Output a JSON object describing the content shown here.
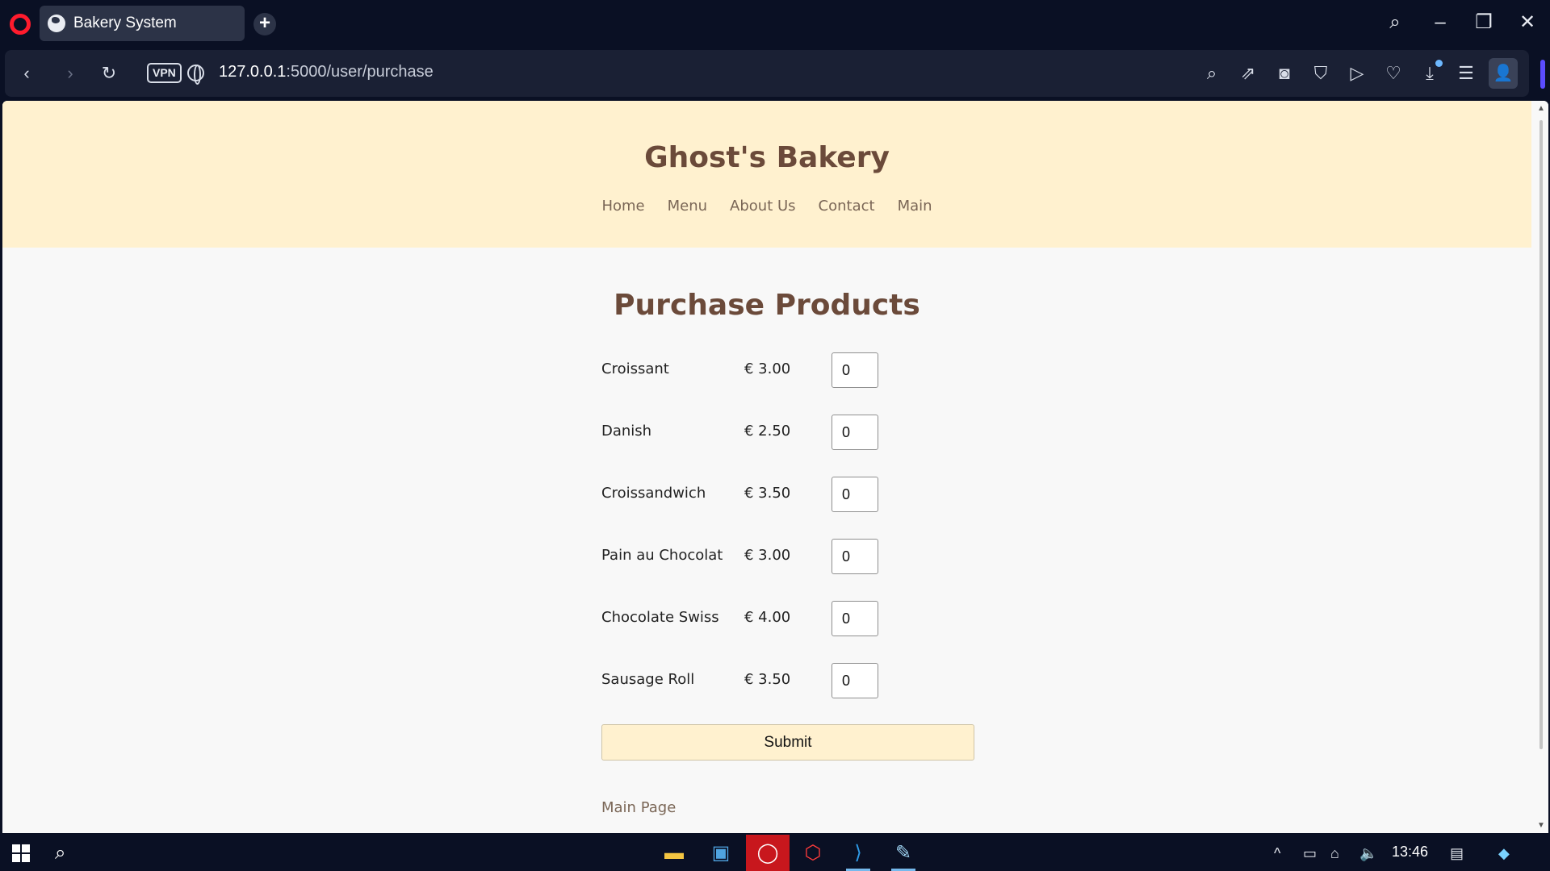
{
  "browser": {
    "tab_title": "Bakery System",
    "url_host": "127.0.0.1",
    "url_path": ":5000/user/purchase",
    "vpn_label": "VPN"
  },
  "site": {
    "brand": "Ghost's Bakery",
    "nav": [
      "Home",
      "Menu",
      "About Us",
      "Contact",
      "Main"
    ]
  },
  "purchase": {
    "title": "Purchase Products",
    "products": [
      {
        "name": "Croissant",
        "price": "€ 3.00",
        "qty": "0"
      },
      {
        "name": "Danish",
        "price": "€ 2.50",
        "qty": "0"
      },
      {
        "name": "Croissandwich",
        "price": "€ 3.50",
        "qty": "0"
      },
      {
        "name": "Pain au Chocolat",
        "price": "€ 3.00",
        "qty": "0"
      },
      {
        "name": "Chocolate Swiss",
        "price": "€ 4.00",
        "qty": "0"
      },
      {
        "name": "Sausage Roll",
        "price": "€ 3.50",
        "qty": "0"
      }
    ],
    "submit_label": "Submit",
    "main_page_link": "Main Page"
  },
  "taskbar": {
    "clock": "13:46"
  },
  "colors": {
    "header_bg": "#fff1cf",
    "brand_text": "#6b4a3a",
    "page_bg": "#f8f8f8",
    "chrome_bg": "#0a1024",
    "opera_red": "#ff1b2d"
  }
}
